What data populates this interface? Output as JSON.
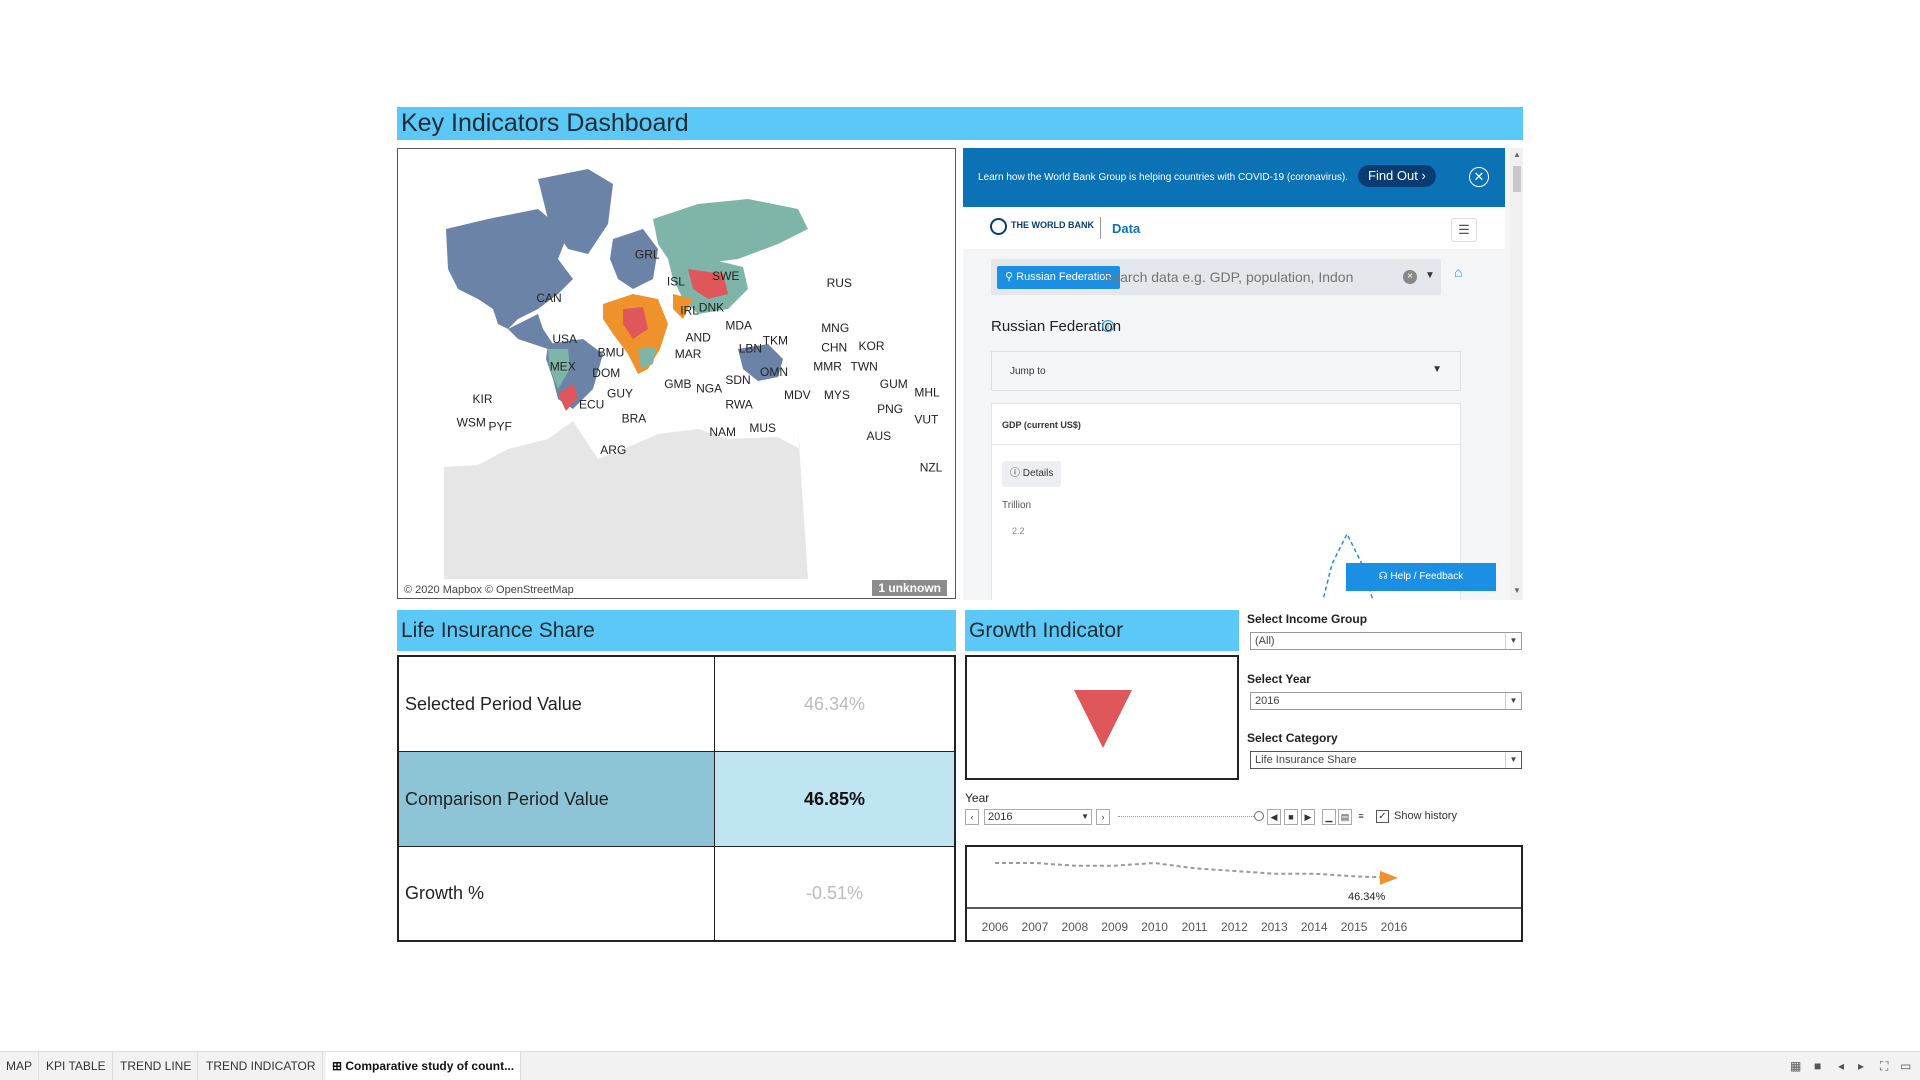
{
  "dashboard": {
    "title": "Key Indicators Dashboard"
  },
  "map": {
    "attribution": "© 2020 Mapbox © OpenStreetMap",
    "unknown_badge": "1 unknown",
    "labels": [
      "GRL",
      "CAN",
      "USA",
      "BMU",
      "MEX",
      "DOM",
      "GUY",
      "ECU",
      "BRA",
      "ARG",
      "KIR",
      "WSM",
      "PYF",
      "ISL",
      "SWE",
      "IRL",
      "DNK",
      "AND",
      "MAR",
      "MDA",
      "LBN",
      "GMB",
      "NGA",
      "SDN",
      "RWA",
      "NAM",
      "MUS",
      "OMN",
      "MDV",
      "TKM",
      "MNG",
      "CHN",
      "KOR",
      "MMR",
      "TWN",
      "MYS",
      "GUM",
      "MHL",
      "PNG",
      "VUT",
      "AUS",
      "NZL",
      "RUS"
    ]
  },
  "worldbank": {
    "banner_text": "Learn how the World Bank Group is helping countries with COVID-19 (coronavirus).",
    "find_out": "Find Out ›",
    "logo": "THE WORLD BANK",
    "data_label": "Data",
    "country_chip": "Russian Federation",
    "search_placeholder": "Search data e.g. GDP, population, Indon",
    "country_title": "Russian Federation",
    "jump_to": "Jump to",
    "gdp_title": "GDP (current US$)",
    "details": "Details",
    "unit": "Trillion",
    "tick": "2.2",
    "help": "Help / Feedback"
  },
  "life_insurance": {
    "title": "Life Insurance Share",
    "rows": [
      {
        "label": "Selected Period Value",
        "value": "46.34%"
      },
      {
        "label": "Comparison Period Value",
        "value": "46.85%"
      },
      {
        "label": "Growth %",
        "value": "-0.51%"
      }
    ]
  },
  "growth": {
    "title": "Growth Indicator",
    "direction": "down",
    "color": "#e0575b"
  },
  "filters": {
    "income_group": {
      "label": "Select Income Group",
      "value": "(All)"
    },
    "year": {
      "label": "Select Year",
      "value": "2016"
    },
    "category": {
      "label": "Select Category",
      "value": "Life Insurance Share"
    }
  },
  "player": {
    "label": "Year",
    "value": "2016",
    "show_history": "Show history"
  },
  "chart_data": {
    "type": "line",
    "x": [
      "2006",
      "2007",
      "2008",
      "2009",
      "2010",
      "2011",
      "2012",
      "2013",
      "2014",
      "2015",
      "2016"
    ],
    "series": [
      {
        "values": [
          46.9,
          46.9,
          46.8,
          46.8,
          46.9,
          46.7,
          46.6,
          46.5,
          46.5,
          46.4,
          46.34
        ]
      }
    ],
    "annotation": "46.34%",
    "colors": {
      "line": "#999999",
      "arrow": "#f0922b"
    }
  },
  "tabs": [
    "MAP",
    "KPI TABLE",
    "TREND LINE",
    "TREND INDICATOR",
    "Comparative study of count..."
  ],
  "colors": {
    "accent": "#5bc8f7",
    "map_blue": "#6b83a6",
    "map_teal": "#7fb5a8",
    "map_orange": "#f0922b",
    "map_red": "#e0575b",
    "kpi_highlight_label": "#8ec5d6",
    "kpi_highlight_value": "#bfe4f2"
  }
}
